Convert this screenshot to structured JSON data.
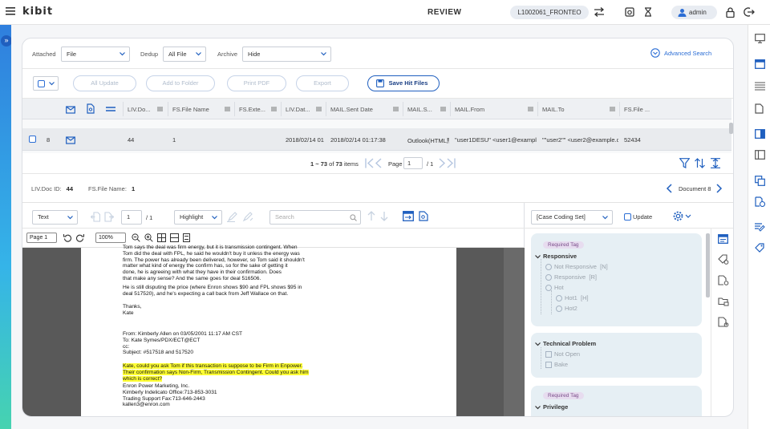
{
  "header": {
    "logo": "kibit",
    "title": "REVIEW",
    "case_id": "L1002061_FRONTEO",
    "user": "admin"
  },
  "filters": {
    "attached_label": "Attached",
    "attached_value": "File",
    "dedup_label": "Dedup",
    "dedup_value": "All File",
    "archive_label": "Archive",
    "archive_value": "Hide",
    "advanced_search": "Advanced Search"
  },
  "toolbar": {
    "all_update": "All Update",
    "add_to_folder": "Add to Folder",
    "print_pdf": "Print PDF",
    "export": "Export",
    "save_hit_files": "Save Hit Files"
  },
  "grid": {
    "columns": [
      "LIV.Do...",
      "FS.File Name",
      "FS.Exte...",
      "LIV.Dat...",
      "MAIL.Sent Date",
      "MAIL.S...",
      "MAIL.From",
      "MAIL.To",
      "FS.File ..."
    ],
    "rows": [
      {
        "index": "8",
        "doc_id": "44",
        "file_name": "1",
        "date": "2018/02/14 01",
        "sent_date": "2018/02/14 01:17:38",
        "subject": "Outlook(HTML形",
        "from": "\"user1DESU\" <user1@exampl",
        "to": "\"\"user2\"\" <user2@example.c",
        "size": "52434"
      }
    ]
  },
  "pager": {
    "range": "1 ~ 73",
    "of_label": "of",
    "total": "73",
    "items_label": "items",
    "page_label": "Page",
    "current_page": "1",
    "total_pages": "/ 1"
  },
  "doc_info": {
    "doc_id_label": "LIV.Doc ID:",
    "doc_id": "44",
    "file_name_label": "FS.File Name:",
    "file_name": "1",
    "document_label": "Document 8"
  },
  "viewer": {
    "mode": "Text",
    "page_input": "1",
    "page_total": "/ 1",
    "highlight": "Highlight",
    "search_placeholder": "Search",
    "page_select": "Page 1",
    "zoom": "100%",
    "lines_a": [
      "Tom says the deal was firm energy, but it is transmission contingent. When",
      "Tom did the deal with FPL, he said he wouldn't buy it unless the energy was",
      "firm. The power has already been delivered, however, so Tom said it shouldn't",
      "matter what kind of energy the confirm has, so for the sake of getting it",
      "done, he is agreeing with what they have in their confirmation. Does",
      "that make any sense? And the same goes for deal 516506."
    ],
    "lines_b": [
      "He is still disputing the price (where Enron shows $90 and FPL shows $95 in",
      "deal 517520), and he's expecting a call back from Jeff Wallace on that."
    ],
    "lines_c": [
      "Thanks,",
      "Kate"
    ],
    "lines_d": [
      "From: Kimberly Allen on 03/05/2001 11:17 AM CST",
      "To: Kate Symes/PDX/ECT@ECT",
      "cc:",
      "Subject: #517518 and 517520"
    ],
    "lines_hl": [
      "Kate, could you ask Tom if this transaction is suppose to be Firm in Enpower.",
      "Their confirmation says Non-Firm, Transmission Contingent. Could you ask him",
      "which is correct?"
    ],
    "lines_e": [
      "Enron Power Marketing, Inc.",
      "Kimberly Indelicato Office:713-853-3031",
      "Trading Support Fax:713-646-2443",
      "kallen3@enron.com"
    ]
  },
  "coding": {
    "set": "[Case Coding Set]",
    "update": "Update",
    "required_tag": "Required Tag",
    "responsive": "Responsive",
    "not_responsive": "Not Responsive",
    "not_responsive_key": "[N]",
    "responsive_opt": "Responsive",
    "responsive_key": "[R]",
    "hot": "Hot",
    "hot1": "Hot1",
    "hot1_key": "[H]",
    "hot2": "Hot2",
    "technical_problem": "Technical Problem",
    "not_open": "Not Open",
    "bake": "Bake",
    "privilege": "Privilege"
  },
  "colors": {
    "accent": "#1f5fbf",
    "link": "#2c6ed5",
    "highlight": "#ffff33",
    "coding_box": "#e6eff4"
  }
}
